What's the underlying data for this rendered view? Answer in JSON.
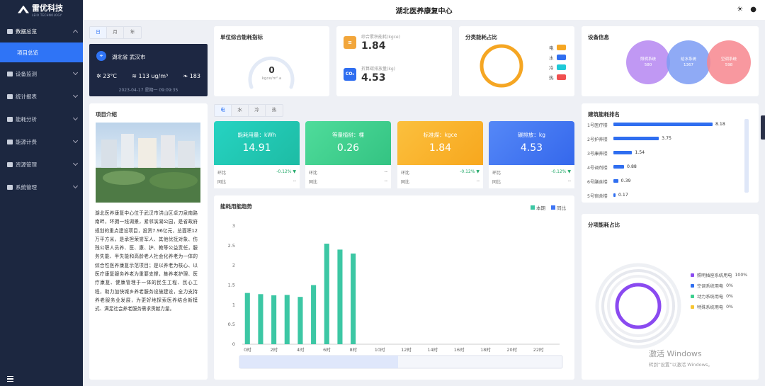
{
  "brand": {
    "name": "雷优科技",
    "sub": "LEIO TECHNOLOGY"
  },
  "header": {
    "title": "湖北医养康复中心"
  },
  "sidebar": {
    "items": [
      {
        "label": "数据总览",
        "icon": "dashboard-icon"
      },
      {
        "label": "设备监测",
        "icon": "monitor-icon"
      },
      {
        "label": "统计报表",
        "icon": "report-icon"
      },
      {
        "label": "能耗分析",
        "icon": "analysis-icon"
      },
      {
        "label": "能源计费",
        "icon": "billing-icon"
      },
      {
        "label": "资源管理",
        "icon": "grid-icon"
      },
      {
        "label": "系统管理",
        "icon": "gear-icon"
      }
    ],
    "active_sub": "项目总览"
  },
  "period_tabs": [
    "日",
    "月",
    "年"
  ],
  "weather": {
    "location": "湖北省 武汉市",
    "temperature": "23°C",
    "pm": "113 ug/m³",
    "aqi": "183",
    "datetime": "2023-04-17 星期一 09:09:35"
  },
  "unit_index": {
    "title": "单位综合能耗指标",
    "value": "0",
    "unit": "kgce/m².a"
  },
  "kpis": [
    {
      "label": "综合累积能耗(kgce)",
      "value": "1.84",
      "icon_text": "≡",
      "color": "#f2a63b"
    },
    {
      "label": "折算碳排放量(kg)",
      "value": "4.53",
      "icon_text": "CO₂",
      "color": "#2f6ef0"
    }
  ],
  "category_share": {
    "title": "分类能耗占比",
    "legend": [
      {
        "name": "电",
        "color": "#f5a623"
      },
      {
        "name": "水",
        "color": "#2f6ef0"
      },
      {
        "name": "冷",
        "color": "#1ec9d8"
      },
      {
        "name": "热",
        "color": "#f04f4f"
      }
    ]
  },
  "device_info": {
    "title": "设备信息",
    "bubbles": [
      {
        "name": "照明系统",
        "value": "580",
        "color": "#b687f2"
      },
      {
        "name": "给水系统",
        "value": "1367",
        "color": "#7c9cf4"
      },
      {
        "name": "空调系统",
        "value": "598",
        "color": "#f7878f"
      }
    ]
  },
  "intro": {
    "title": "项目介绍",
    "text": "湖北医养康复中心位于武汉市洪山区卓刀泉南路南畔，环拥一线湖景，紧邻滨湖公园，是省政府规划的重点建设项目，投资7.96亿元，总面积12万平方米，是承担荣誉军人、其他优抚对象、伤残公职人员养、医、康、护、教等公益责任，服务失能、半失能和高龄老人社会化养老为一体的综合性医养康复示范项目；是以养老为核心、以医疗康复服务养老为重要支撑，集养老护理、医疗康复、健康管理于一体的民生工程、民心工程，助力加快城乡养老服务设施建设，全力支持养老服务业发展，为更好地探索医养结合新模式、满足社会养老服务需求贡献力量。"
  },
  "energy_tabs": [
    "电",
    "水",
    "冷",
    "热"
  ],
  "tiles": [
    {
      "title": "能耗用量：kWh",
      "value": "14.91",
      "ring_label": "环比",
      "ring_value": "-0.12% ▼",
      "yoy_label": "同比",
      "yoy_value": "--",
      "color": "#22c9b4"
    },
    {
      "title": "等量植树：棵",
      "value": "0.26",
      "ring_label": "环比",
      "ring_value": "--",
      "yoy_label": "同比",
      "yoy_value": "--",
      "color": "#3ccf8e"
    },
    {
      "title": "标准煤：kgce",
      "value": "1.84",
      "ring_label": "环比",
      "ring_value": "-0.12% ▼",
      "yoy_label": "同比",
      "yoy_value": "--",
      "color": "#f9b02a"
    },
    {
      "title": "碳排放：kg",
      "value": "4.53",
      "ring_label": "环比",
      "ring_value": "-0.12% ▼",
      "yoy_label": "同比",
      "yoy_value": "--",
      "color": "#3d74f4"
    }
  ],
  "ranking": {
    "title": "建筑能耗排名",
    "items": [
      {
        "name": "1号医疗楼",
        "value": 8.18
      },
      {
        "name": "2号护养楼",
        "value": 3.75
      },
      {
        "name": "3号康养楼",
        "value": 1.54
      },
      {
        "name": "4号调剂楼",
        "value": 0.88
      },
      {
        "name": "6号膳食楼",
        "value": 0.39
      },
      {
        "name": "5号宿舍楼",
        "value": 0.17
      }
    ]
  },
  "subitem": {
    "title": "分项能耗占比",
    "legend": [
      {
        "name": "照明插座系统用电",
        "value": "100%",
        "color": "#8a4af0"
      },
      {
        "name": "空调系统用电",
        "value": "0%",
        "color": "#2f6ef0"
      },
      {
        "name": "动力系统用电",
        "value": "0%",
        "color": "#3ccf8e"
      },
      {
        "name": "特殊系统用电",
        "value": "0%",
        "color": "#f7c531"
      }
    ]
  },
  "chart_data": {
    "type": "bar",
    "title": "能耗用能趋势",
    "legend": [
      {
        "name": "本期",
        "color": "#3cc7a4"
      },
      {
        "name": "同比",
        "color": "#3d74f4"
      }
    ],
    "categories": [
      "0时",
      "1时",
      "2时",
      "3时",
      "4时",
      "5时",
      "6时",
      "7时",
      "8时",
      "9时",
      "10时",
      "11时",
      "12时",
      "13时",
      "14时",
      "15时",
      "16时",
      "17时",
      "18时",
      "19时",
      "20时",
      "21时",
      "22时",
      "23时"
    ],
    "x_tick_labels": [
      "0时",
      "2时",
      "4时",
      "6时",
      "8时",
      "10时",
      "12时",
      "14时",
      "16时",
      "18时",
      "20时",
      "22时"
    ],
    "series": [
      {
        "name": "本期",
        "values": [
          1.3,
          1.27,
          1.24,
          1.25,
          1.2,
          1.5,
          2.55,
          2.4,
          2.3,
          null,
          null,
          null,
          null,
          null,
          null,
          null,
          null,
          null,
          null,
          null,
          null,
          null,
          null,
          null
        ]
      }
    ],
    "ylim": [
      0,
      3
    ],
    "yticks": [
      "0",
      "0.5",
      "1",
      "1.5",
      "2",
      "2.5",
      "3"
    ]
  },
  "watermark": {
    "line1": "激活 Windows",
    "line2": "转到“设置”以激活 Windows。"
  }
}
